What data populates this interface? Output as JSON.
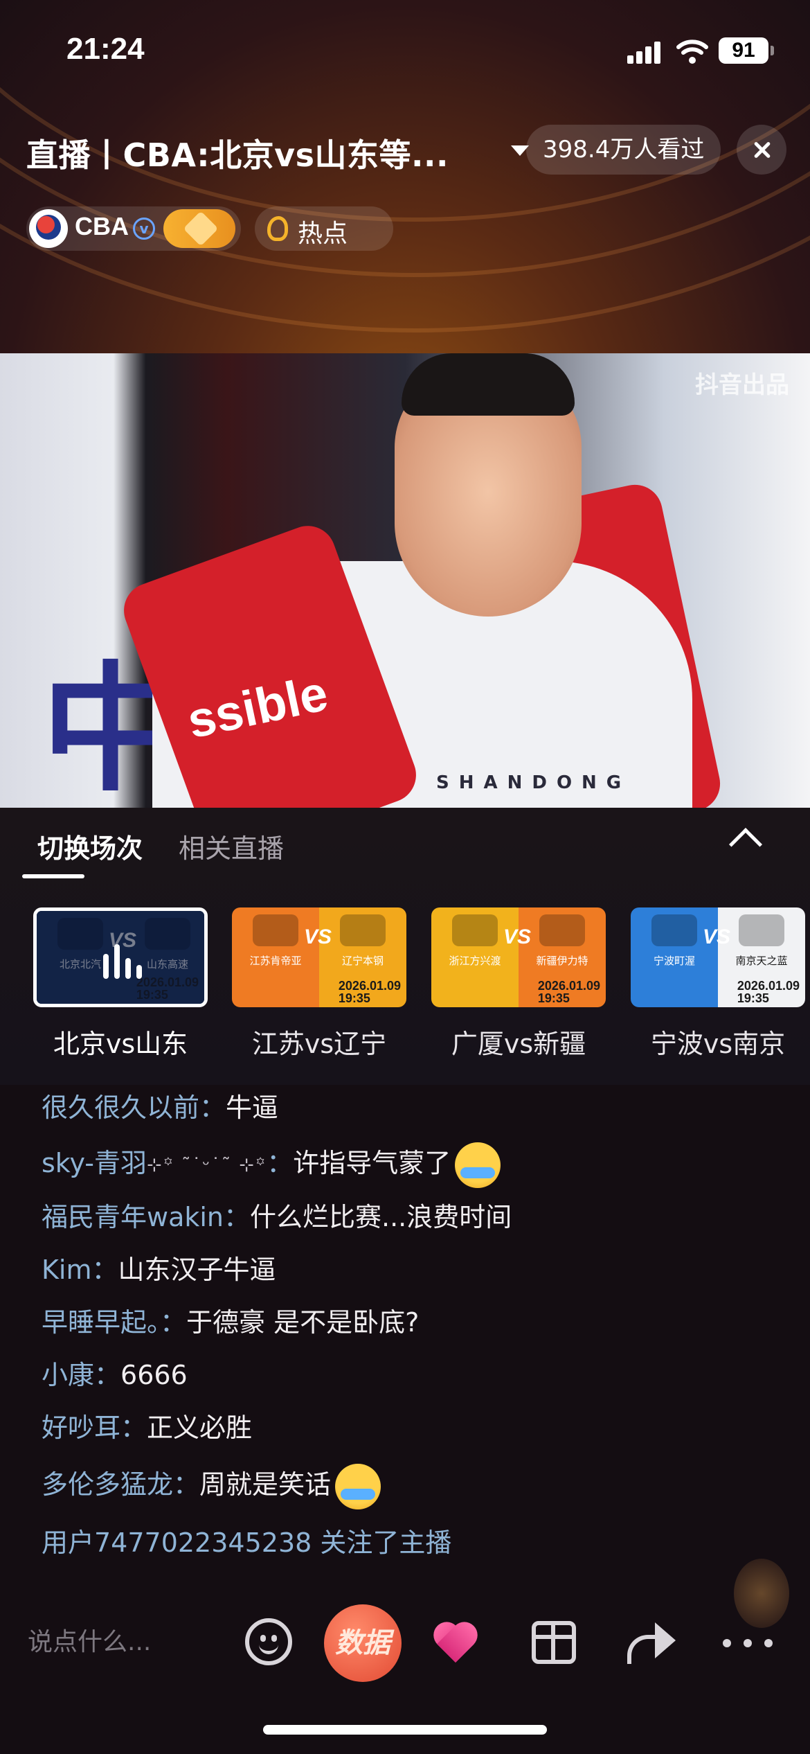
{
  "status_bar": {
    "time": "21:24",
    "battery": "91"
  },
  "header": {
    "title": "直播丨CBA:北京vs山东等...",
    "viewers": "398.4万人看过",
    "anchor_name": "CBA",
    "verified_mark": "v",
    "hot_label": "热点"
  },
  "video": {
    "watermark": "抖音出品",
    "towel_text": "ssible",
    "shirt_text": "SHANDONG",
    "background_char": "中"
  },
  "switch_panel": {
    "tab_active": "切换场次",
    "tab_inactive": "相关直播",
    "matches": [
      {
        "label": "北京vs山东",
        "home": "北京北汽",
        "away": "山东高速",
        "date": "2026.01.09",
        "time": "19:35",
        "left_color": "#1d3560",
        "right_color": "#1d3560",
        "selected": true
      },
      {
        "label": "江苏vs辽宁",
        "home": "江苏肯帝亚",
        "away": "辽宁本钢",
        "date": "2026.01.09",
        "time": "19:35",
        "left_color": "#ef7b23",
        "right_color": "#f2a81c",
        "selected": false
      },
      {
        "label": "广厦vs新疆",
        "home": "浙江方兴渡",
        "away": "新疆伊力特",
        "date": "2026.01.09",
        "time": "19:35",
        "left_color": "#f2b21c",
        "right_color": "#ef7b23",
        "selected": false
      },
      {
        "label": "宁波vs南京",
        "home": "宁波町渥",
        "away": "南京天之蓝",
        "date": "2026.01.09",
        "time": "19:35",
        "left_color": "#2d7fd9",
        "right_color": "#f1f2f4",
        "selected": false
      }
    ]
  },
  "chat": [
    {
      "user": "很久很久以前：",
      "msg": "牛逼"
    },
    {
      "user": "sky-青羽",
      "sparkle": "⊹꙳ ˜˙ᵕ˙˜ ⊹꙳",
      "sep": "：",
      "msg": "许指导气蒙了"
    },
    {
      "user": "福民青年wakin：",
      "msg": "什么烂比赛...浪费时间"
    },
    {
      "user": "Kim：",
      "msg": "山东汉子牛逼"
    },
    {
      "user": "早睡早起。：",
      "msg": "于德豪 是不是卧底?"
    },
    {
      "user": "小康：",
      "msg": "6666"
    },
    {
      "user": "好吵耳：",
      "msg": "正义必胜"
    },
    {
      "user": "多伦多猛龙：",
      "msg": "周就是笑话"
    },
    {
      "user": "用户7477022345238",
      "msg": " 关注了主播"
    }
  ],
  "bottom_bar": {
    "input_placeholder": "说点什么...",
    "data_label": "数据"
  }
}
